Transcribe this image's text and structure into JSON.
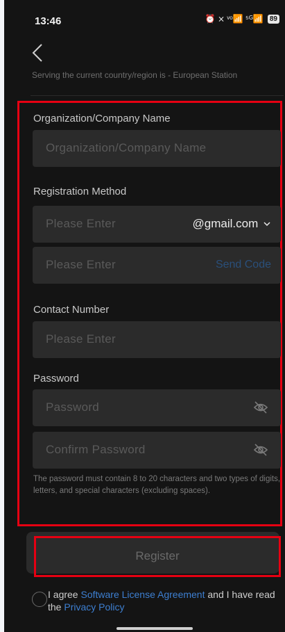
{
  "status_bar": {
    "time": "13:46",
    "icons": "⏰ ⨯ ᵛᵒ📶 ⁵ᴳ📶",
    "battery": "89"
  },
  "server": {
    "note": "Serving the current country/region is - European Station"
  },
  "form": {
    "org": {
      "label": "Organization/Company Name",
      "placeholder": "Organization/Company Name"
    },
    "registration": {
      "label": "Registration Method",
      "email_placeholder": "Please Enter",
      "domain": "@gmail.com",
      "code_placeholder": "Please Enter",
      "send_code": "Send Code"
    },
    "contact": {
      "label": "Contact Number",
      "placeholder": "Please Enter"
    },
    "password": {
      "label": "Password",
      "placeholder": "Password",
      "confirm_placeholder": "Confirm Password",
      "hint": "The password must contain 8 to 20 characters and two types of digits, letters, and special characters (excluding spaces)."
    }
  },
  "register_label": "Register",
  "agreement": {
    "prefix": "I agree ",
    "license_link": "Software License Agreement",
    "middle": " and I have read the ",
    "privacy_link": "Privacy Policy"
  },
  "colors": {
    "highlight": "#e60012",
    "link": "#3d7fd1",
    "background": "#141414",
    "field": "#2b2b2b"
  }
}
